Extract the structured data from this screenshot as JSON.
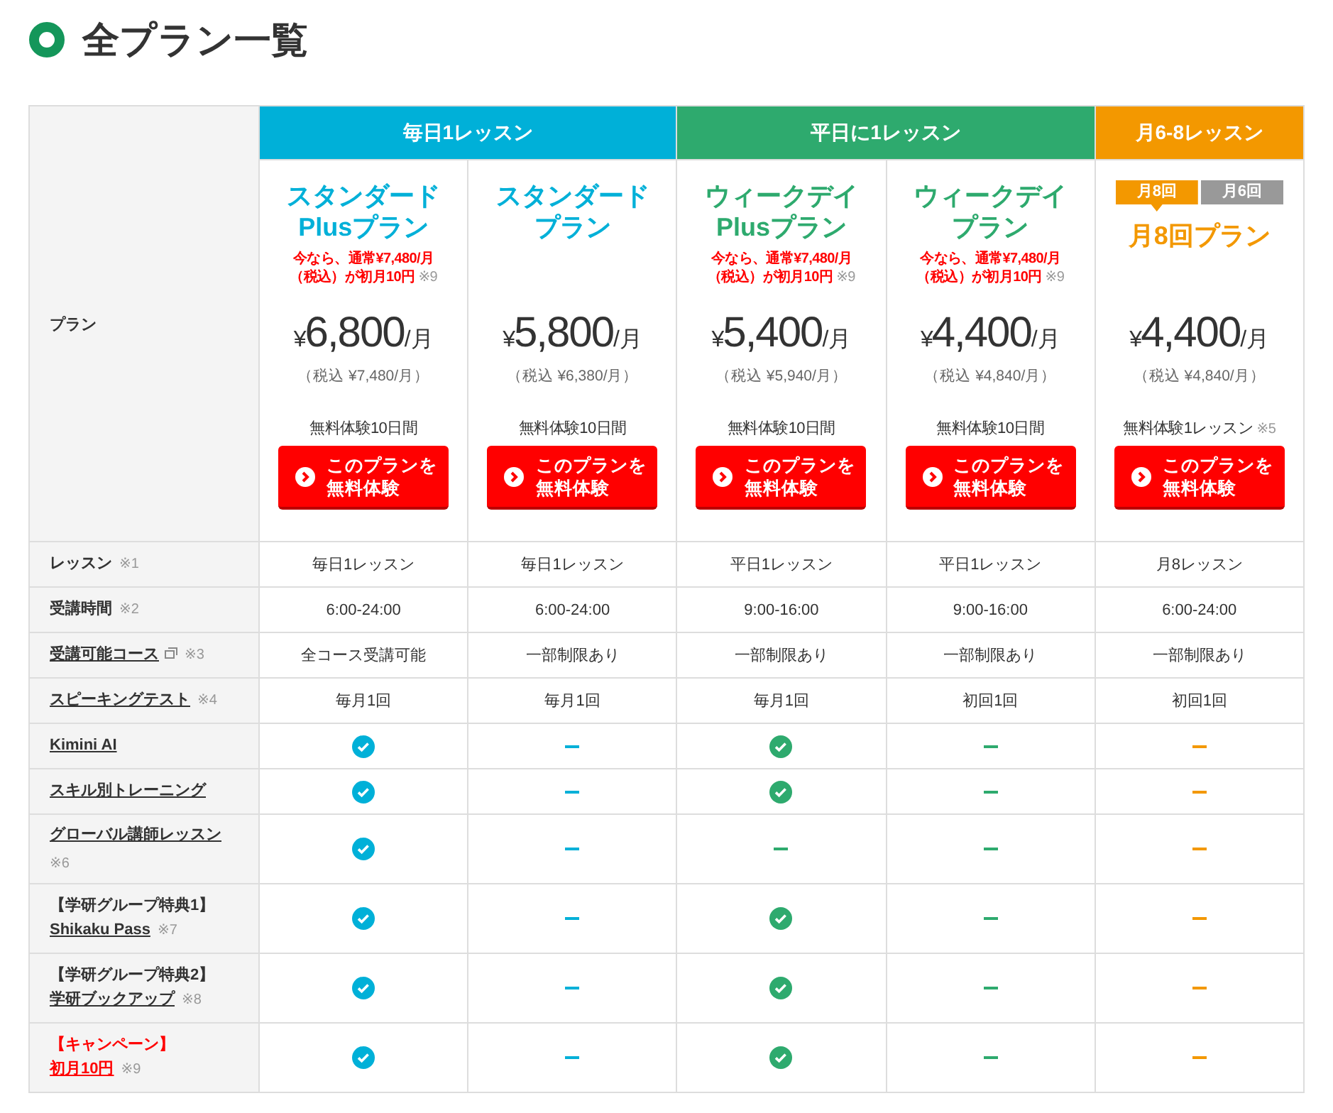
{
  "title": "全プラン一覧",
  "plan_header": "プラン",
  "groups": [
    {
      "label": "毎日1レッスン",
      "color": "#00b0d8",
      "plans": [
        {
          "name": [
            "スタンダード",
            "Plusプラン"
          ],
          "promo": [
            "今なら、通常¥7,480/月",
            "（税込）が初月10円"
          ],
          "promo_note": "※9",
          "currency": "¥",
          "price": "6,800",
          "unit": "/月",
          "tax": "（税込 ¥7,480/月）",
          "trial": "無料体験10日間",
          "button": [
            "このプランを",
            "無料体験"
          ]
        },
        {
          "name": [
            "スタンダード",
            "プラン"
          ],
          "currency": "¥",
          "price": "5,800",
          "unit": "/月",
          "tax": "（税込 ¥6,380/月）",
          "trial": "無料体験10日間",
          "button": [
            "このプランを",
            "無料体験"
          ]
        }
      ]
    },
    {
      "label": "平日に1レッスン",
      "color": "#2eaa6e",
      "plans": [
        {
          "name": [
            "ウィークデイ",
            "Plusプラン"
          ],
          "promo": [
            "今なら、通常¥7,480/月",
            "（税込）が初月10円"
          ],
          "promo_note": "※9",
          "currency": "¥",
          "price": "5,400",
          "unit": "/月",
          "tax": "（税込 ¥5,940/月）",
          "trial": "無料体験10日間",
          "button": [
            "このプランを",
            "無料体験"
          ]
        },
        {
          "name": [
            "ウィークデイ",
            "プラン"
          ],
          "promo": [
            "今なら、通常¥7,480/月",
            "（税込）が初月10円"
          ],
          "promo_note": "※9",
          "currency": "¥",
          "price": "4,400",
          "unit": "/月",
          "tax": "（税込 ¥4,840/月）",
          "trial": "無料体験10日間",
          "button": [
            "このプランを",
            "無料体験"
          ]
        }
      ]
    },
    {
      "label": "月6-8レッスン",
      "color": "#f39800",
      "plans": [
        {
          "tabs": [
            {
              "label": "月8回",
              "selected": true
            },
            {
              "label": "月6回",
              "selected": false
            }
          ],
          "name": [
            "月8回プラン"
          ],
          "currency": "¥",
          "price": "4,400",
          "unit": "/月",
          "tax": "（税込 ¥4,840/月）",
          "trial": "無料体験1レッスン",
          "trial_note": "※5",
          "button": [
            "このプランを",
            "無料体験"
          ]
        }
      ]
    }
  ],
  "rows": [
    {
      "kind": "text",
      "label": "レッスン",
      "link": false,
      "note": "※1",
      "cells": [
        "毎日1レッスン",
        "毎日1レッスン",
        "平日1レッスン",
        "平日1レッスン",
        "月8レッスン"
      ]
    },
    {
      "kind": "text",
      "label": "受講時間",
      "link": false,
      "note": "※2",
      "cells": [
        "6:00-24:00",
        "6:00-24:00",
        "9:00-16:00",
        "9:00-16:00",
        "6:00-24:00"
      ]
    },
    {
      "kind": "text",
      "label": "受講可能コース",
      "link": true,
      "external": true,
      "note": "※3",
      "cells": [
        "全コース受講可能",
        "一部制限あり",
        "一部制限あり",
        "一部制限あり",
        "一部制限あり"
      ]
    },
    {
      "kind": "text",
      "label": "スピーキングテスト",
      "link": true,
      "note": "※4",
      "cells": [
        "毎月1回",
        "毎月1回",
        "毎月1回",
        "初回1回",
        "初回1回"
      ]
    },
    {
      "kind": "check",
      "label": "Kimini AI",
      "link": true,
      "cells": [
        {
          "included": true
        },
        {
          "included": false
        },
        {
          "included": true
        },
        {
          "included": false
        },
        {
          "included": false
        }
      ]
    },
    {
      "kind": "check",
      "label": "スキル別トレーニング",
      "link": true,
      "cells": [
        {
          "included": true
        },
        {
          "included": false
        },
        {
          "included": true
        },
        {
          "included": false
        },
        {
          "included": false
        }
      ]
    },
    {
      "kind": "check",
      "label": "グローバル講師レッスン",
      "link": true,
      "note": "※6",
      "note_below": true,
      "cells": [
        {
          "included": true
        },
        {
          "included": false
        },
        {
          "included": false
        },
        {
          "included": false
        },
        {
          "included": false
        }
      ]
    },
    {
      "kind": "check",
      "prefix": "【学研グループ特典1】",
      "label": "Shikaku Pass",
      "link": true,
      "note": "※7",
      "cells": [
        {
          "included": true
        },
        {
          "included": false
        },
        {
          "included": true
        },
        {
          "included": false
        },
        {
          "included": false
        }
      ]
    },
    {
      "kind": "check",
      "prefix": "【学研グループ特典2】",
      "label": "学研ブックアップ",
      "link": true,
      "note": "※8",
      "cells": [
        {
          "included": true
        },
        {
          "included": false
        },
        {
          "included": true
        },
        {
          "included": false
        },
        {
          "included": false
        }
      ]
    },
    {
      "kind": "check",
      "prefix": "【キャンペーン】",
      "label": "初月10円",
      "link": true,
      "highlight": true,
      "note": "※9",
      "cells": [
        {
          "included": true
        },
        {
          "included": false
        },
        {
          "included": true
        },
        {
          "included": false
        },
        {
          "included": false
        }
      ]
    }
  ]
}
